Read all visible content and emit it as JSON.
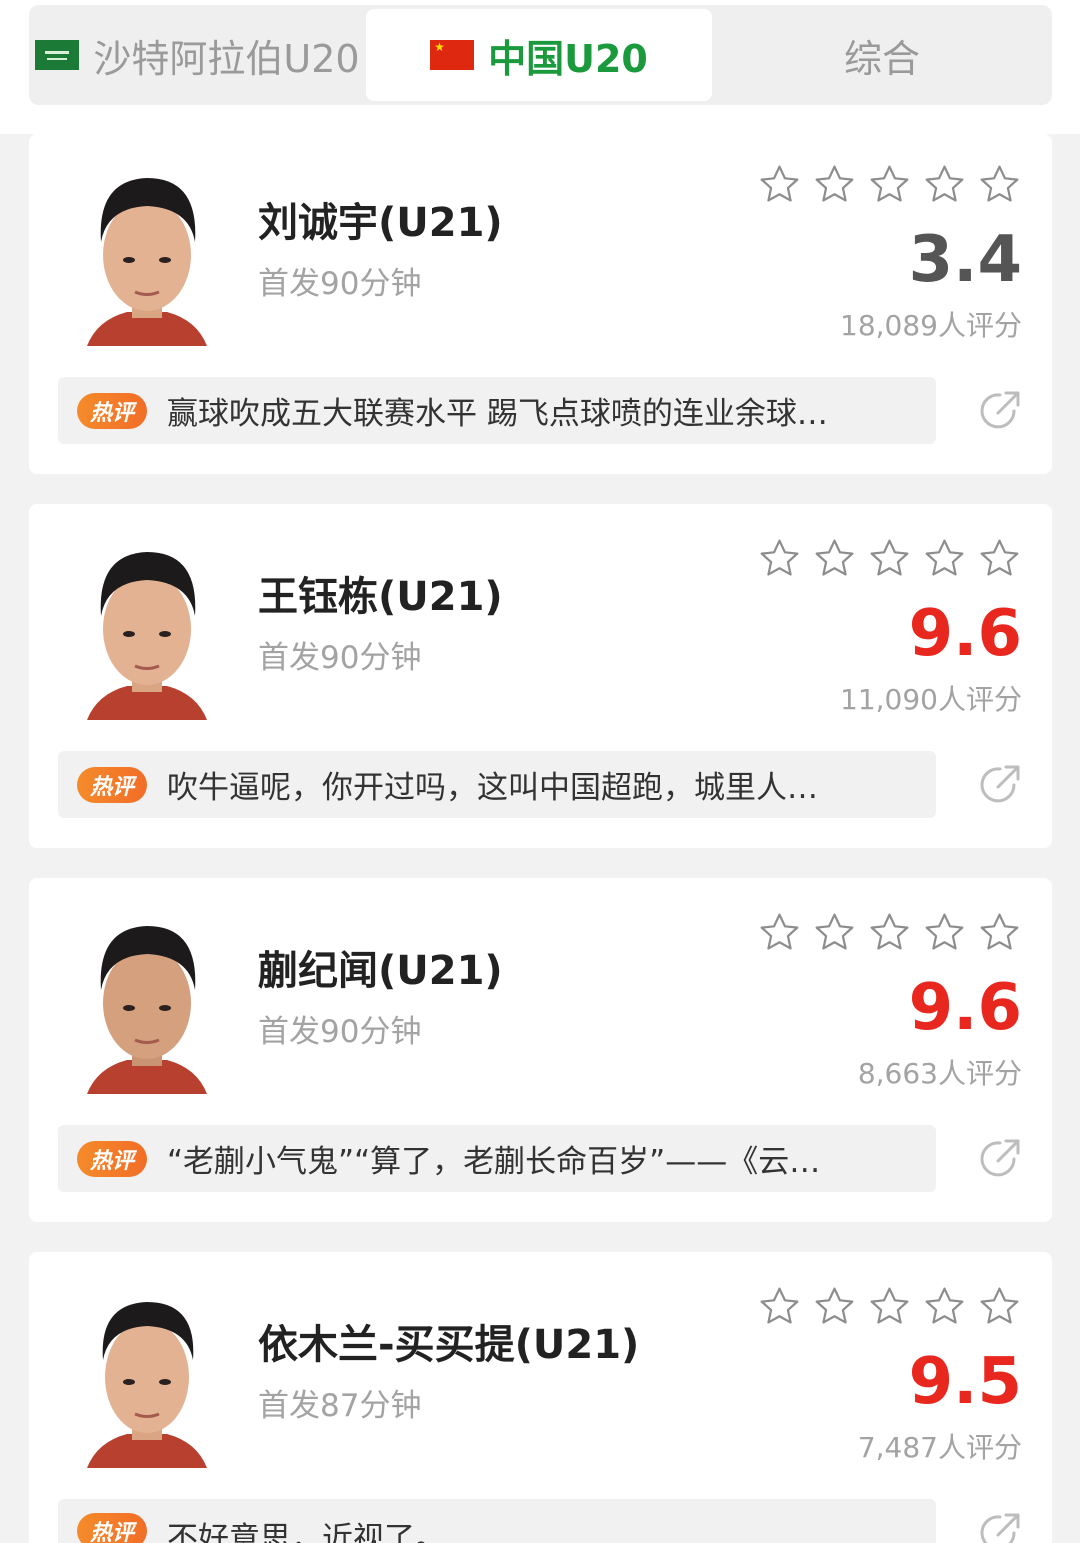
{
  "tabs": [
    {
      "label": "沙特阿拉伯U20",
      "flag": "saudi-flag-icon"
    },
    {
      "label": "中国U20",
      "flag": "china-flag-icon",
      "active": true
    },
    {
      "label": "综合"
    }
  ],
  "colors": {
    "accent": "#1a9a3c",
    "score_low": "#555555",
    "score_high": "#e8281f",
    "badge": "#f47b29"
  },
  "players": [
    {
      "name": "刘诚宇(U21)",
      "minutes": "首发90分钟",
      "score": "3.4",
      "votes": "18,089人评分",
      "badge": "热评",
      "comment": "赢球吹成五大联赛水平 踢飞点球喷的连业余球…"
    },
    {
      "name": "王钰栋(U21)",
      "minutes": "首发90分钟",
      "score": "9.6",
      "votes": "11,090人评分",
      "badge": "热评",
      "comment": "吹牛逼呢，你开过吗，这叫中国超跑，城里人…"
    },
    {
      "name": "蒯纪闻(U21)",
      "minutes": "首发90分钟",
      "score": "9.6",
      "votes": "8,663人评分",
      "badge": "热评",
      "comment": "“老蒯小气鬼”“算了，老蒯长命百岁”——《云…"
    },
    {
      "name": "依木兰-买买提(U21)",
      "minutes": "首发87分钟",
      "score": "9.5",
      "votes": "7,487人评分",
      "badge": "热评",
      "comment": "不好意思，近视了。"
    }
  ]
}
